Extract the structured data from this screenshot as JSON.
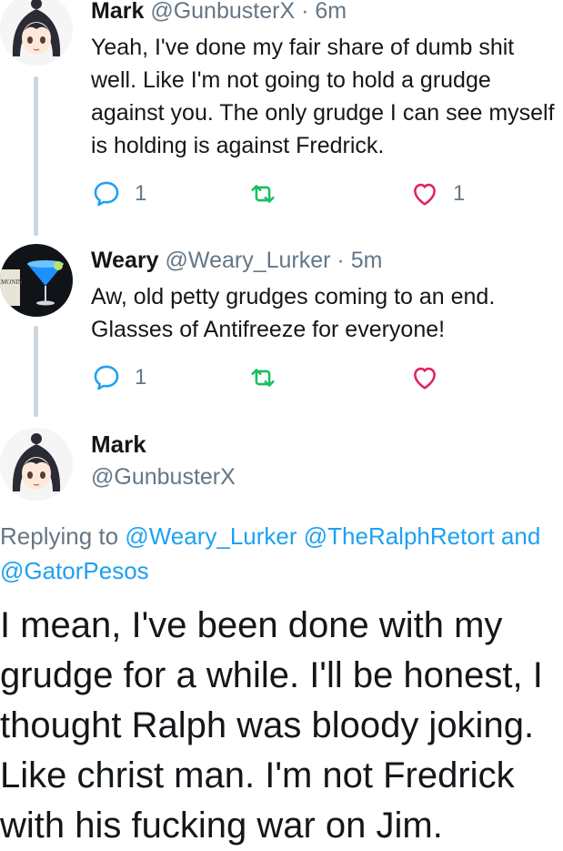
{
  "tweets": [
    {
      "name": "Mark",
      "handle": "@GunbusterX",
      "sep": " · ",
      "time": "6m",
      "text": "Yeah, I've done my fair share of dumb shit well. Like I'm not going to hold a grudge against you. The only grudge I can see myself is holding is against Fredrick.",
      "replies": "1",
      "retweets": "",
      "likes": "1"
    },
    {
      "name": "Weary",
      "handle": "@Weary_Lurker",
      "sep": " · ",
      "time": "5m",
      "text": "Aw, old petty grudges coming to an end. Glasses of Antifreeze for everyone!",
      "replies": "1",
      "retweets": "",
      "likes": ""
    }
  ],
  "main_tweet": {
    "name": "Mark",
    "handle": "@GunbusterX",
    "replying_prefix": "Replying to",
    "mention_1": "@Weary_Lurker",
    "mention_2": "@TheRalphRetort",
    "and": "and",
    "mention_3": "@GatorPesos",
    "text": "I mean, I've been done with my grudge for a while. I'll be honest, I thought Ralph was bloody joking. Like christ man. I'm not Fredrick with his fucking war on Jim."
  },
  "avatar_labels": {
    "drink_label": "MONIN"
  },
  "colors": {
    "link": "#1da1f2",
    "meta": "#657786",
    "thread_line": "#ccd6dd"
  }
}
